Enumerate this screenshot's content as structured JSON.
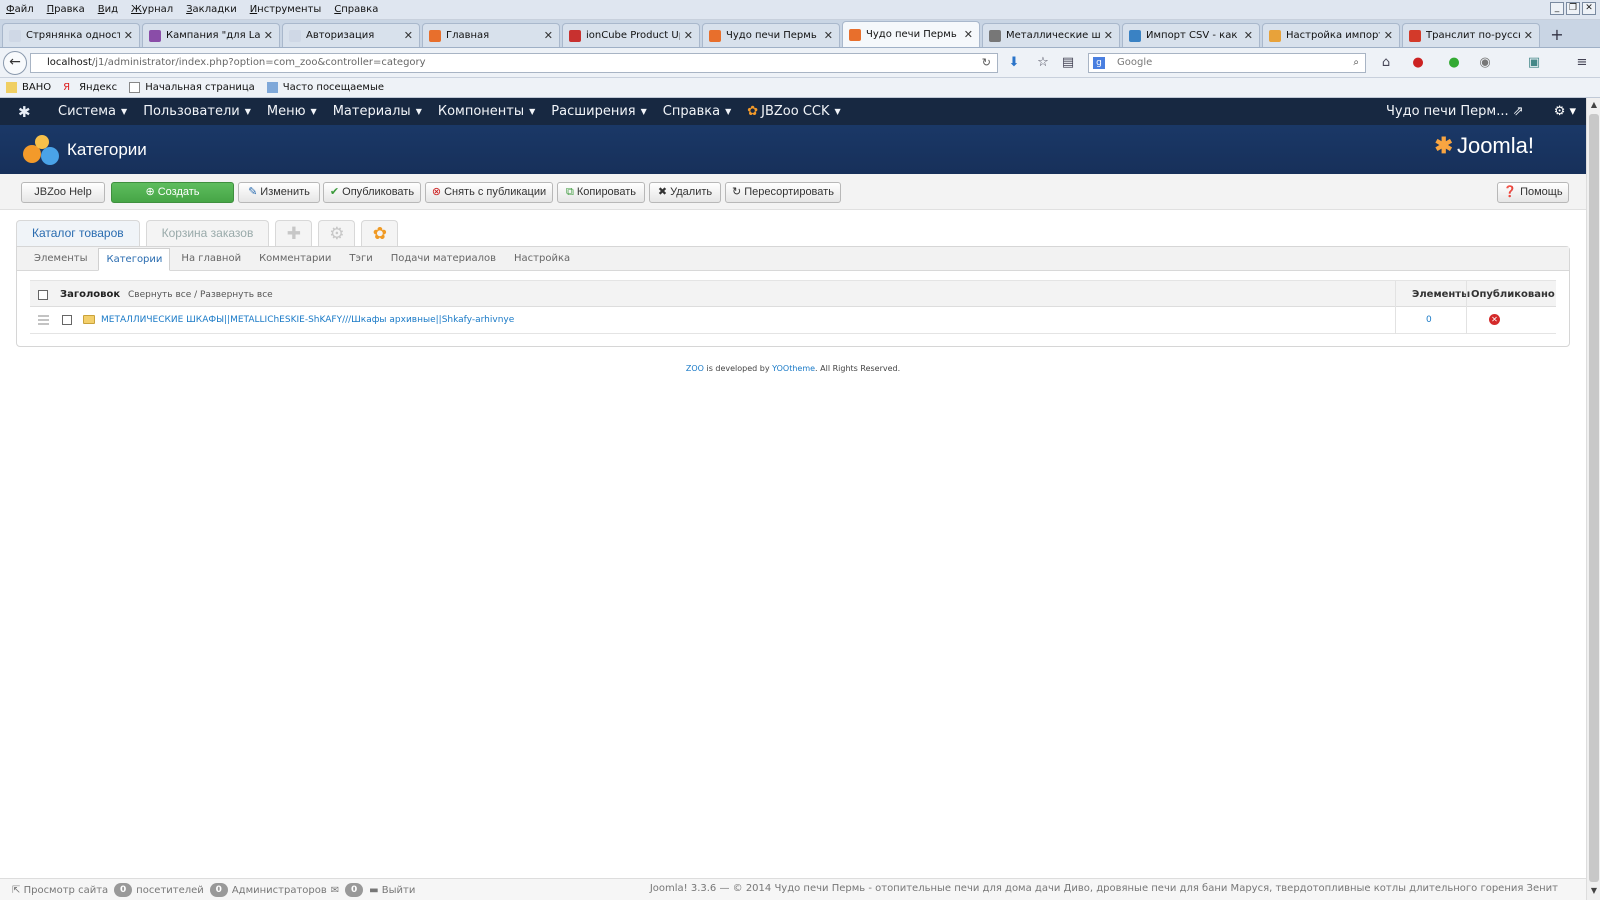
{
  "browser": {
    "menu": [
      "Файл",
      "Правка",
      "Вид",
      "Журнал",
      "Закладки",
      "Инструменты",
      "Справка"
    ],
    "tabs": [
      {
        "label": "Стрянянка односторон...",
        "color": "#cfd8e6"
      },
      {
        "label": "Кампания \"для Labu...",
        "color": "#8a4da8"
      },
      {
        "label": "Авторизация",
        "color": "#cfd8e6"
      },
      {
        "label": "Главная",
        "color": "#e86f2c"
      },
      {
        "label": "ionCube Product Upd...",
        "color": "#c8312f"
      },
      {
        "label": "Чудо печи Пермь - ...",
        "color": "#e86f2c"
      },
      {
        "label": "Чудо печи Пермь - ...",
        "color": "#e86f2c"
      },
      {
        "label": "Металлические шк...",
        "color": "#777777"
      },
      {
        "label": "Импорт CSV - как эт...",
        "color": "#3a82c4"
      },
      {
        "label": "Настройка импорта...",
        "color": "#e8a23a"
      },
      {
        "label": "Транслит по-русски",
        "color": "#d33a2a"
      }
    ],
    "active_tab_index": 6,
    "url_host": "localhost",
    "url_path": "/j1/administrator/index.php?option=com_zoo&controller=category",
    "search_placeholder": "Google",
    "bookmarks": [
      "ВАНО",
      "Яндекс",
      "Начальная страница",
      "Часто посещаемые"
    ]
  },
  "joomla": {
    "nav": [
      {
        "label": "Система"
      },
      {
        "label": "Пользователи"
      },
      {
        "label": "Меню"
      },
      {
        "label": "Материалы"
      },
      {
        "label": "Компоненты"
      },
      {
        "label": "Расширения"
      },
      {
        "label": "Справка"
      },
      {
        "label": "JBZoo CCK"
      }
    ],
    "site_name": "Чудо печи Перм...",
    "page_title": "Категории",
    "brand": "Joomla!",
    "toolbar": {
      "jbzoo_help": "JBZoo Help",
      "create": "Создать",
      "edit": "Изменить",
      "publish": "Опубликовать",
      "unpublish": "Снять с публикации",
      "copy": "Копировать",
      "delete": "Удалить",
      "reorder": "Пересортировать",
      "help": "Помощь"
    },
    "app_tabs": [
      {
        "label": "Каталог товаров"
      },
      {
        "label": "Корзина заказов"
      }
    ],
    "sub_tabs": [
      "Элементы",
      "Категории",
      "На главной",
      "Комментарии",
      "Тэги",
      "Подачи материалов",
      "Настройка"
    ],
    "active_sub_tab": "Категории",
    "table": {
      "col_title": "Заголовок",
      "collapse_expand": "Свернуть все / Развернуть все",
      "col_elements": "Элементы",
      "col_published": "Опубликовано",
      "rows": [
        {
          "title": "МЕТАЛЛИЧЕСКИЕ ШКАФЫ||METALLIChESKIE-ShKAFY///Шкафы архивные||Shkafy-arhivnye",
          "elements": "0",
          "published": false
        }
      ]
    },
    "footer": {
      "zoo": "ZOO",
      "developed_by": "is developed by",
      "yootheme": "YOOtheme",
      "rights": ". All Rights Reserved."
    },
    "status": {
      "view_site": "Просмотр сайта",
      "visitors_count": "0",
      "visitors_label": "посетителей",
      "admins_count": "0",
      "admins_label": "Администраторов",
      "messages_count": "0",
      "logout": "Выйти",
      "copyright": "Joomla! 3.3.6 — © 2014 Чудо печи Пермь - отопительные печи для дома дачи Диво, дровяные печи для бани Маруся, твердотопливные котлы длительного горения Зенит"
    }
  }
}
